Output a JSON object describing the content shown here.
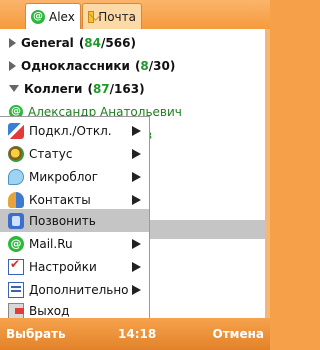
{
  "tabs": [
    {
      "label": "Alex",
      "icon": "at-icon"
    },
    {
      "label": "Почта",
      "icon": "envelope-icon"
    }
  ],
  "groups": [
    {
      "name": "General",
      "online": "84",
      "total": "566",
      "expanded": false
    },
    {
      "name": "Одноклассники",
      "online": "8",
      "total": "30",
      "expanded": false
    },
    {
      "name": "Коллеги",
      "online": "87",
      "total": "163",
      "expanded": true
    }
  ],
  "contacts": [
    {
      "name": "Александр Анатольевич",
      "partial": "в"
    }
  ],
  "menu": {
    "items": [
      {
        "label": "Подкл./Откл.",
        "icon": "connect-icon",
        "has_submenu": true
      },
      {
        "label": "Статус",
        "icon": "status-icon",
        "has_submenu": true
      },
      {
        "label": "Микроблог",
        "icon": "microblog-icon",
        "has_submenu": true
      },
      {
        "label": "Контакты",
        "icon": "contacts-icon",
        "has_submenu": true
      },
      {
        "label": "Позвонить",
        "icon": "phone-icon",
        "has_submenu": false,
        "selected": true
      },
      {
        "label": "Mail.Ru",
        "icon": "mailru-icon",
        "has_submenu": true
      },
      {
        "label": "Настройки",
        "icon": "settings-icon",
        "has_submenu": true
      },
      {
        "label": "Дополнительно",
        "icon": "more-icon",
        "has_submenu": true
      },
      {
        "label": "Выход",
        "icon": "exit-icon",
        "has_submenu": false
      }
    ]
  },
  "softkeys": {
    "left": "Выбрать",
    "time": "14:18",
    "right": "Отмена"
  },
  "colors": {
    "accent": "#f59b3e",
    "online_green": "#1f9a2a",
    "selection": "#c5c5c5"
  }
}
